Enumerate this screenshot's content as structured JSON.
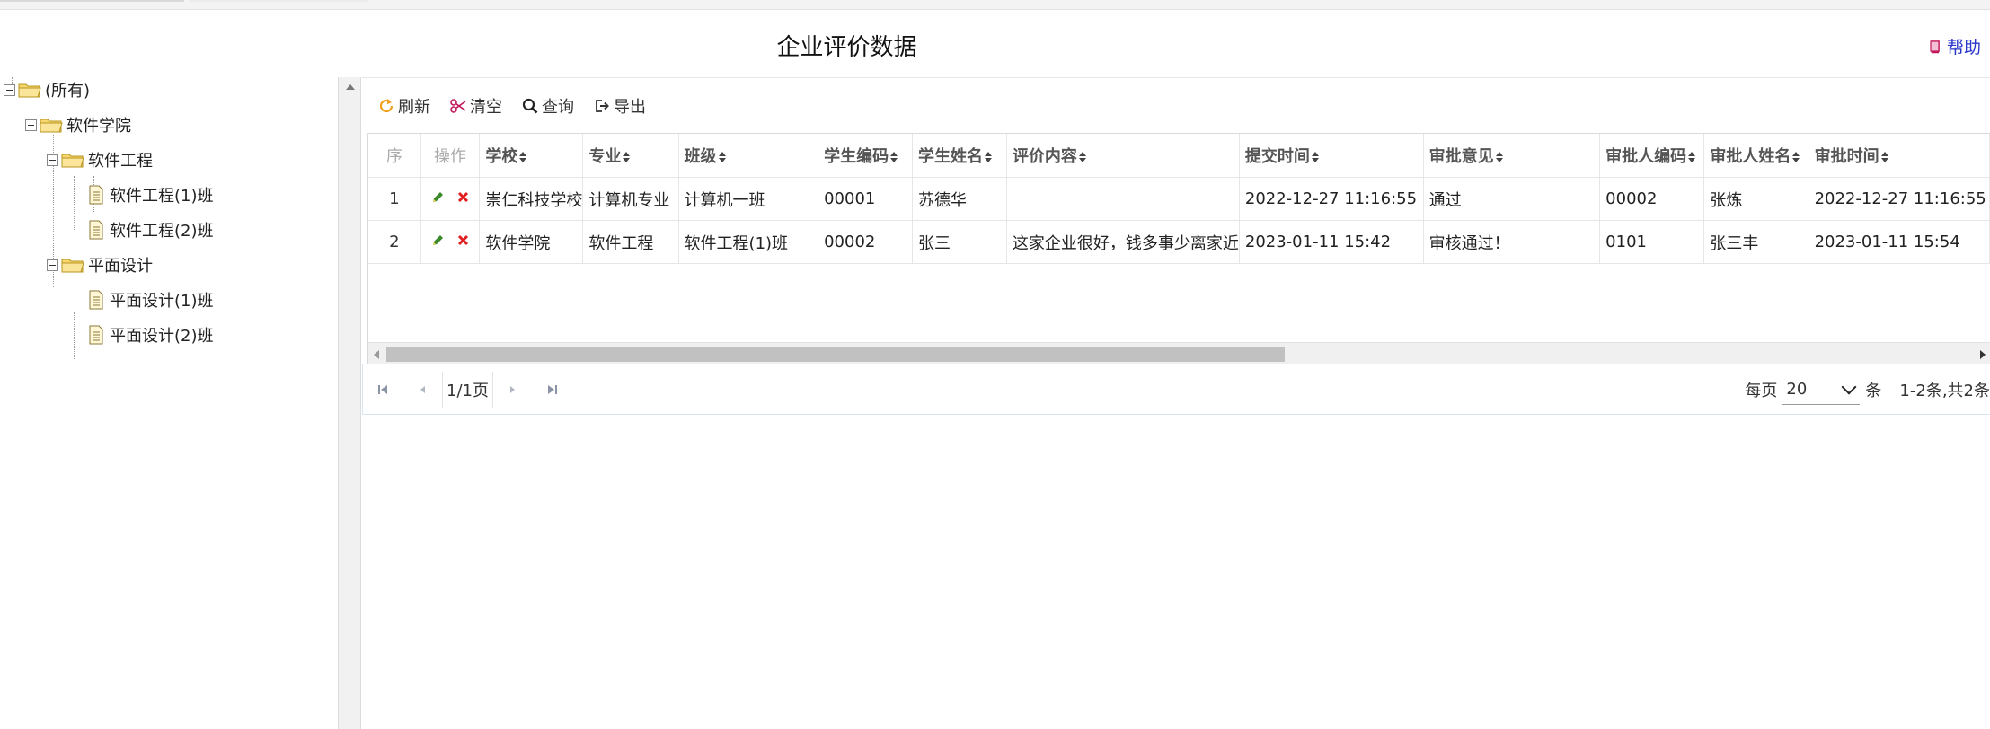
{
  "page": {
    "title": "企业评价数据",
    "help_label": "帮助"
  },
  "tree": {
    "root": "(所有)",
    "college": "软件学院",
    "major1": "软件工程",
    "class1": "软件工程(1)班",
    "class2": "软件工程(2)班",
    "major2": "平面设计",
    "class3": "平面设计(1)班",
    "class4": "平面设计(2)班"
  },
  "toolbar": {
    "refresh": "刷新",
    "clear": "清空",
    "query": "查询",
    "export": "导出"
  },
  "table": {
    "headers": {
      "index": "序",
      "op": "操作",
      "school": "学校",
      "major": "专业",
      "class": "班级",
      "student_code": "学生编码",
      "student_name": "学生姓名",
      "content": "评价内容",
      "submit_time": "提交时间",
      "opinion": "审批意见",
      "approver_code": "审批人编码",
      "approver_name": "审批人姓名",
      "approve_time": "审批时间"
    },
    "rows": [
      {
        "index": "1",
        "school": "崇仁科技学校",
        "major": "计算机专业",
        "class": "计算机一班",
        "student_code": "00001",
        "student_name": "苏德华",
        "content": "",
        "submit_time": "2022-12-27 11:16:55",
        "opinion": "通过",
        "approver_code": "00002",
        "approver_name": "张炼",
        "approve_time": "2022-12-27 11:16:55"
      },
      {
        "index": "2",
        "school": "软件学院",
        "major": "软件工程",
        "class": "软件工程(1)班",
        "student_code": "00002",
        "student_name": "张三",
        "content": "这家企业很好，钱多事少离家近",
        "submit_time": "2023-01-11 15:42",
        "opinion": "审核通过！",
        "approver_code": "0101",
        "approver_name": "张三丰",
        "approve_time": "2023-01-11 15:54"
      }
    ]
  },
  "pager": {
    "page_info": "1/1页",
    "per_page_label": "每页",
    "per_page_value": "20",
    "unit": "条",
    "range": "1-2条,共2条"
  },
  "colors": {
    "help": "#2a36c9",
    "refresh_icon": "#f0a020",
    "clear_icon": "#c2185b",
    "edit_icon": "#3a8a2a",
    "delete_icon": "#e02020"
  }
}
